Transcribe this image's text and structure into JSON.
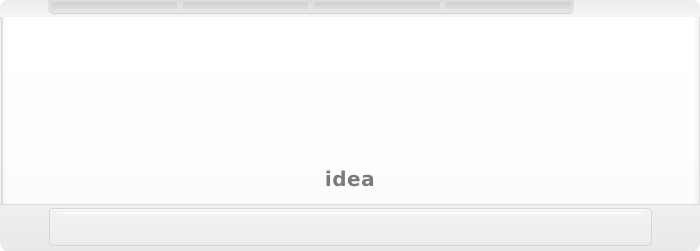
{
  "product": {
    "brand": "idea"
  },
  "colors": {
    "body": "#fbfbfb",
    "logo": "#7b7b7b",
    "louver": "#ececec"
  }
}
